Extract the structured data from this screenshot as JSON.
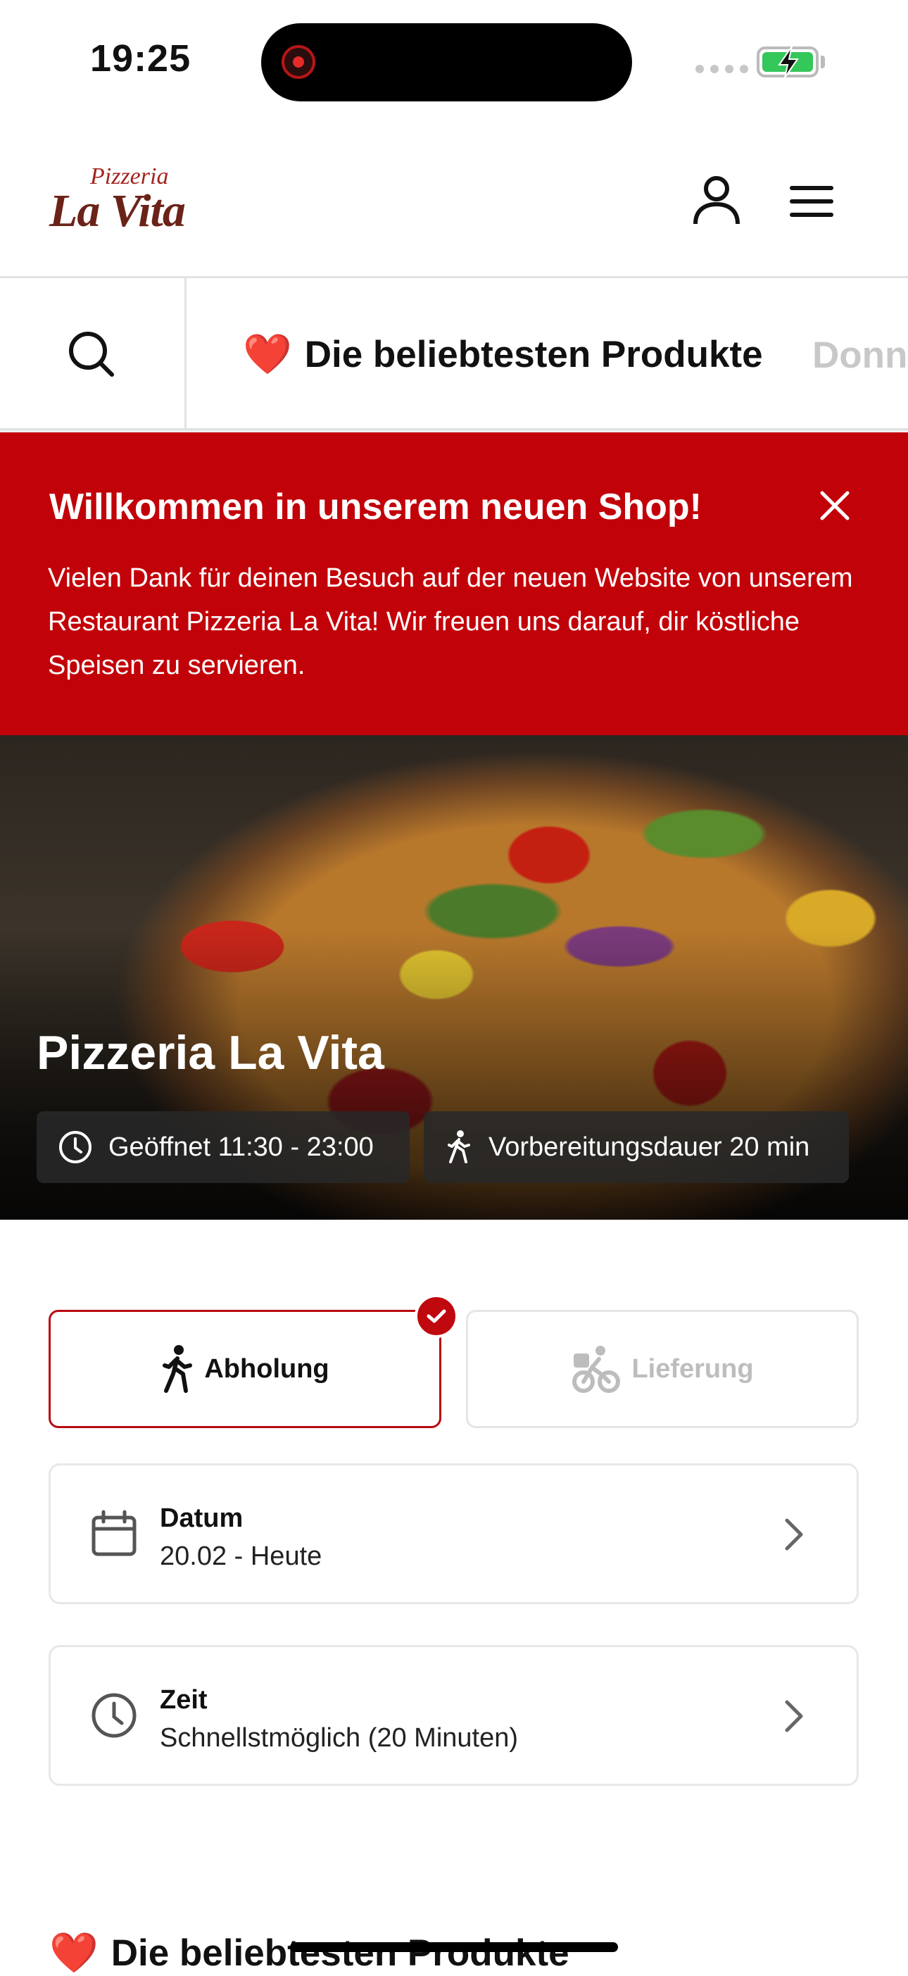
{
  "status_bar": {
    "time": "19:25"
  },
  "header": {
    "logo_small": "Pizzeria",
    "logo_big": "La Vita",
    "icons": [
      "user-icon",
      "menu-icon"
    ]
  },
  "categories": {
    "active_emoji": "❤️",
    "active_label": "Die beliebtesten Produkte",
    "next_label": "Donn"
  },
  "banner": {
    "title": "Willkommen in unserem neuen Shop!",
    "text": "Vielen Dank für deinen Besuch auf der neuen Website von unserem Restaurant Pizzeria La Vita! Wir freuen uns darauf, dir köstliche Speisen zu servieren."
  },
  "hero": {
    "title": "Pizzeria La Vita",
    "opening": "Geöffnet 11:30 - 23:00",
    "preparation": "Vorbereitungsdauer 20 min"
  },
  "order_type": {
    "pickup_label": "Abholung",
    "delivery_label": "Lieferung",
    "selected": "Abholung"
  },
  "date": {
    "label": "Datum",
    "value": "20.02 - Heute"
  },
  "time": {
    "label": "Zeit",
    "value": "Schnellstmöglich (20 Minuten)"
  },
  "section": {
    "emoji": "❤️",
    "title": "Die beliebtesten Produkte"
  },
  "colors": {
    "brand_red": "#c20209",
    "accent_border": "#b80b12",
    "battery_green": "#34c759"
  }
}
